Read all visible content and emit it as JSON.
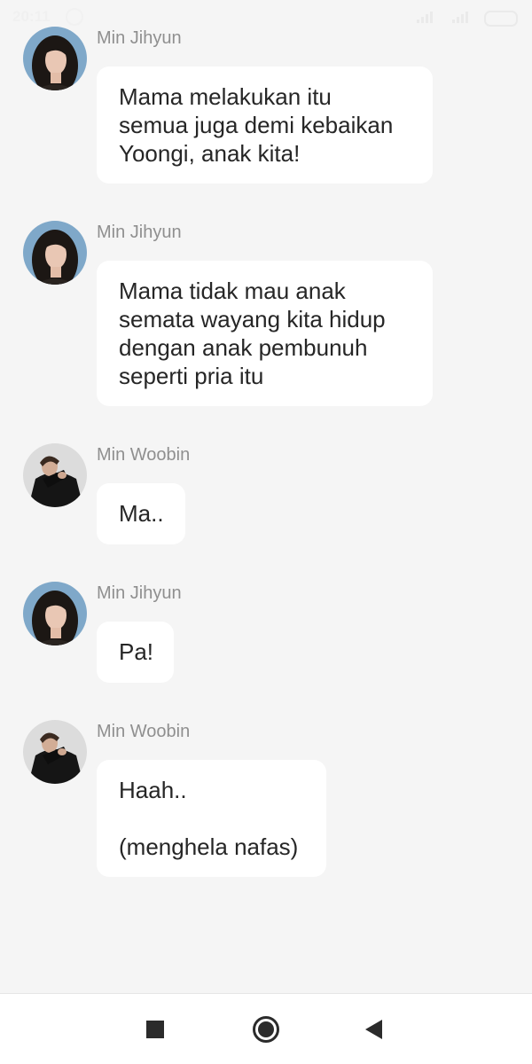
{
  "status_bar": {
    "time": "20:11"
  },
  "messages": [
    {
      "sender": "Min Jihyun",
      "avatar": "woman-portrait-avatar",
      "text": "Mama melakukan itu\nsemua juga demi kebaikan\nYoongi, anak kita!"
    },
    {
      "sender": "Min Jihyun",
      "avatar": "woman-portrait-avatar",
      "text": "Mama tidak mau anak\nsemata wayang kita hidup\ndengan anak pembunuh\nseperti pria itu"
    },
    {
      "sender": "Min Woobin",
      "avatar": "man-portrait-avatar",
      "text": "Ma.."
    },
    {
      "sender": "Min Jihyun",
      "avatar": "woman-portrait-avatar",
      "text": "Pa!"
    },
    {
      "sender": "Min Woobin",
      "avatar": "man-portrait-avatar",
      "text": "Haah..\n\n(menghela nafas)"
    }
  ],
  "navbar": {
    "recents_icon": "square-icon",
    "home_icon": "home-circle-icon",
    "back_icon": "back-triangle-icon"
  },
  "colors": {
    "background": "#f5f5f5",
    "bubble": "#ffffff",
    "sender_text": "#8f8f8f",
    "message_text": "#262626"
  }
}
